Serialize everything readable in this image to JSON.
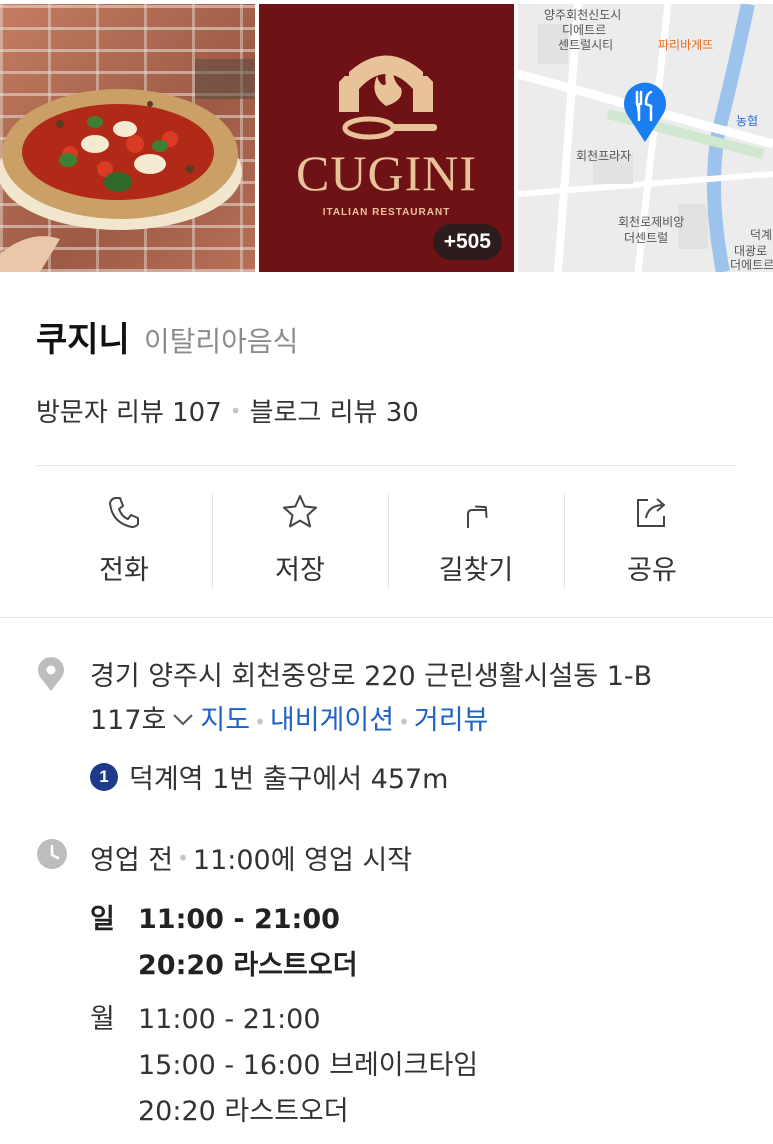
{
  "photos": {
    "badge": "+505",
    "logo_name": "CUGINI",
    "logo_sub": "ITALIAN RESTAURANT",
    "map_labels": [
      "양주회천신도시",
      "디에트르",
      "센트럴시티",
      "파리바게뜨",
      "농협",
      "회천프라자",
      "회천로제비앙",
      "더센트럴",
      "덕계",
      "대광로",
      "더에트르"
    ]
  },
  "place": {
    "name": "쿠지니",
    "category": "이탈리아음식",
    "visitor_reviews": "방문자 리뷰 107",
    "blog_reviews": "블로그 리뷰 30"
  },
  "actions": {
    "call": "전화",
    "save": "저장",
    "directions": "길찾기",
    "share": "공유"
  },
  "address": {
    "line1": "경기 양주시 회천중앙로 220 근린생활시설동 1-B",
    "line2": "117호",
    "map_link": "지도",
    "navi_link": "내비게이션",
    "street_link": "거리뷰"
  },
  "transit": {
    "line_number": "1",
    "line_color": "#1e3a8a",
    "text": "덕계역 1번 출구에서 457m"
  },
  "hours": {
    "status": "영업 전",
    "status_note": "11:00에 영업 시작",
    "days": [
      {
        "day": "일",
        "lines": [
          "11:00 - 21:00",
          "20:20 라스트오더"
        ],
        "today": true
      },
      {
        "day": "월",
        "lines": [
          "11:00 - 21:00",
          "15:00 - 16:00 브레이크타임",
          "20:20 라스트오더"
        ],
        "today": false
      }
    ]
  },
  "colors": {
    "link": "#1f62c8",
    "map_pin": "#1a7ef0",
    "logo_bg": "#6f1216"
  }
}
